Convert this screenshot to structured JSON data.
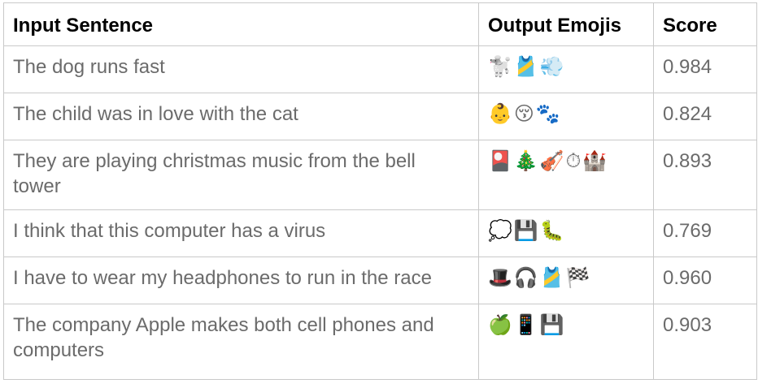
{
  "table": {
    "headers": {
      "sentence": "Input Sentence",
      "emojis": "Output Emojis",
      "score": "Score"
    },
    "rows": [
      {
        "sentence": "The dog runs fast",
        "emojis": "🐩🎽💨",
        "score": "0.984"
      },
      {
        "sentence": "The child was in love with the cat",
        "emojis": "👶😚🐾",
        "score": "0.824"
      },
      {
        "sentence": "They are playing christmas music from the bell tower",
        "emojis": "🎴🎄🎻⏱🏰",
        "score": "0.893"
      },
      {
        "sentence": "I think that this computer has a virus",
        "emojis": "💭💾🐛",
        "score": "0.769"
      },
      {
        "sentence": "I have to wear my headphones to run in the race",
        "emojis": "🎩🎧🎽🏁",
        "score": "0.960"
      },
      {
        "sentence": "The company Apple makes both cell phones and computers",
        "emojis": "🍏📱💾",
        "score": "0.903"
      }
    ]
  }
}
